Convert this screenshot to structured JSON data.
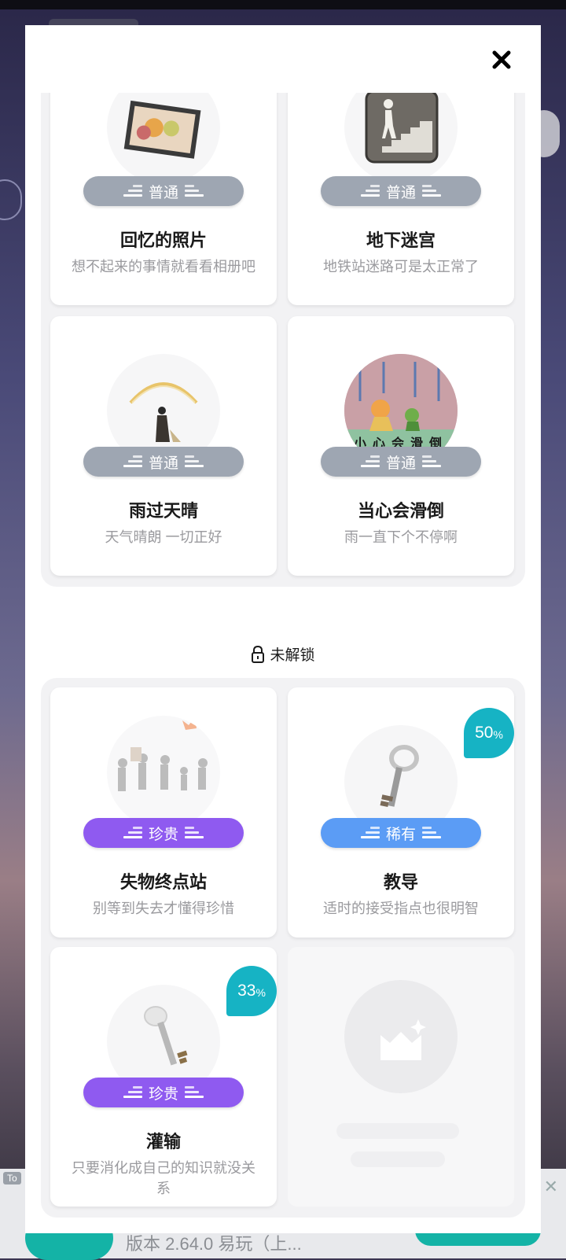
{
  "modal": {
    "close_label": "✕",
    "unlocked_cards": [
      {
        "title": "回忆的照片",
        "desc": "想不起来的事情就看看相册吧",
        "rarity": "普通"
      },
      {
        "title": "地下迷宫",
        "desc": "地铁站迷路可是太正常了",
        "rarity": "普通"
      },
      {
        "title": "雨过天晴",
        "desc": "天气晴朗 一切正好",
        "rarity": "普通"
      },
      {
        "title": "当心会滑倒",
        "desc": "雨一直下个不停啊",
        "rarity": "普通"
      }
    ],
    "locked_section_label": "未解锁",
    "locked_cards": [
      {
        "title": "失物终点站",
        "desc": "别等到失去才懂得珍惜",
        "rarity": "珍贵",
        "progress": null
      },
      {
        "title": "教导",
        "desc": "适时的接受指点也很明智",
        "rarity": "稀有",
        "progress": "50"
      },
      {
        "title": "灌输",
        "desc": "只要消化成自己的知识就没关系",
        "rarity": "珍贵",
        "progress": "33"
      }
    ],
    "percent_sign": "%",
    "thumb4_text": "小心会滑倒"
  },
  "background": {
    "ad_tag": "To",
    "ad_version": "版本 2.64.0   易玩（上..."
  },
  "colors": {
    "common": "#9ea6b2",
    "rare": "#5b9cf5",
    "precious": "#8f5af0",
    "progress": "#16b3c4"
  },
  "icons": [
    "close-icon",
    "lock-icon",
    "rarity-bars-icon",
    "photo-icon",
    "stairs-icon",
    "key-icon",
    "placeholder-image-icon"
  ]
}
